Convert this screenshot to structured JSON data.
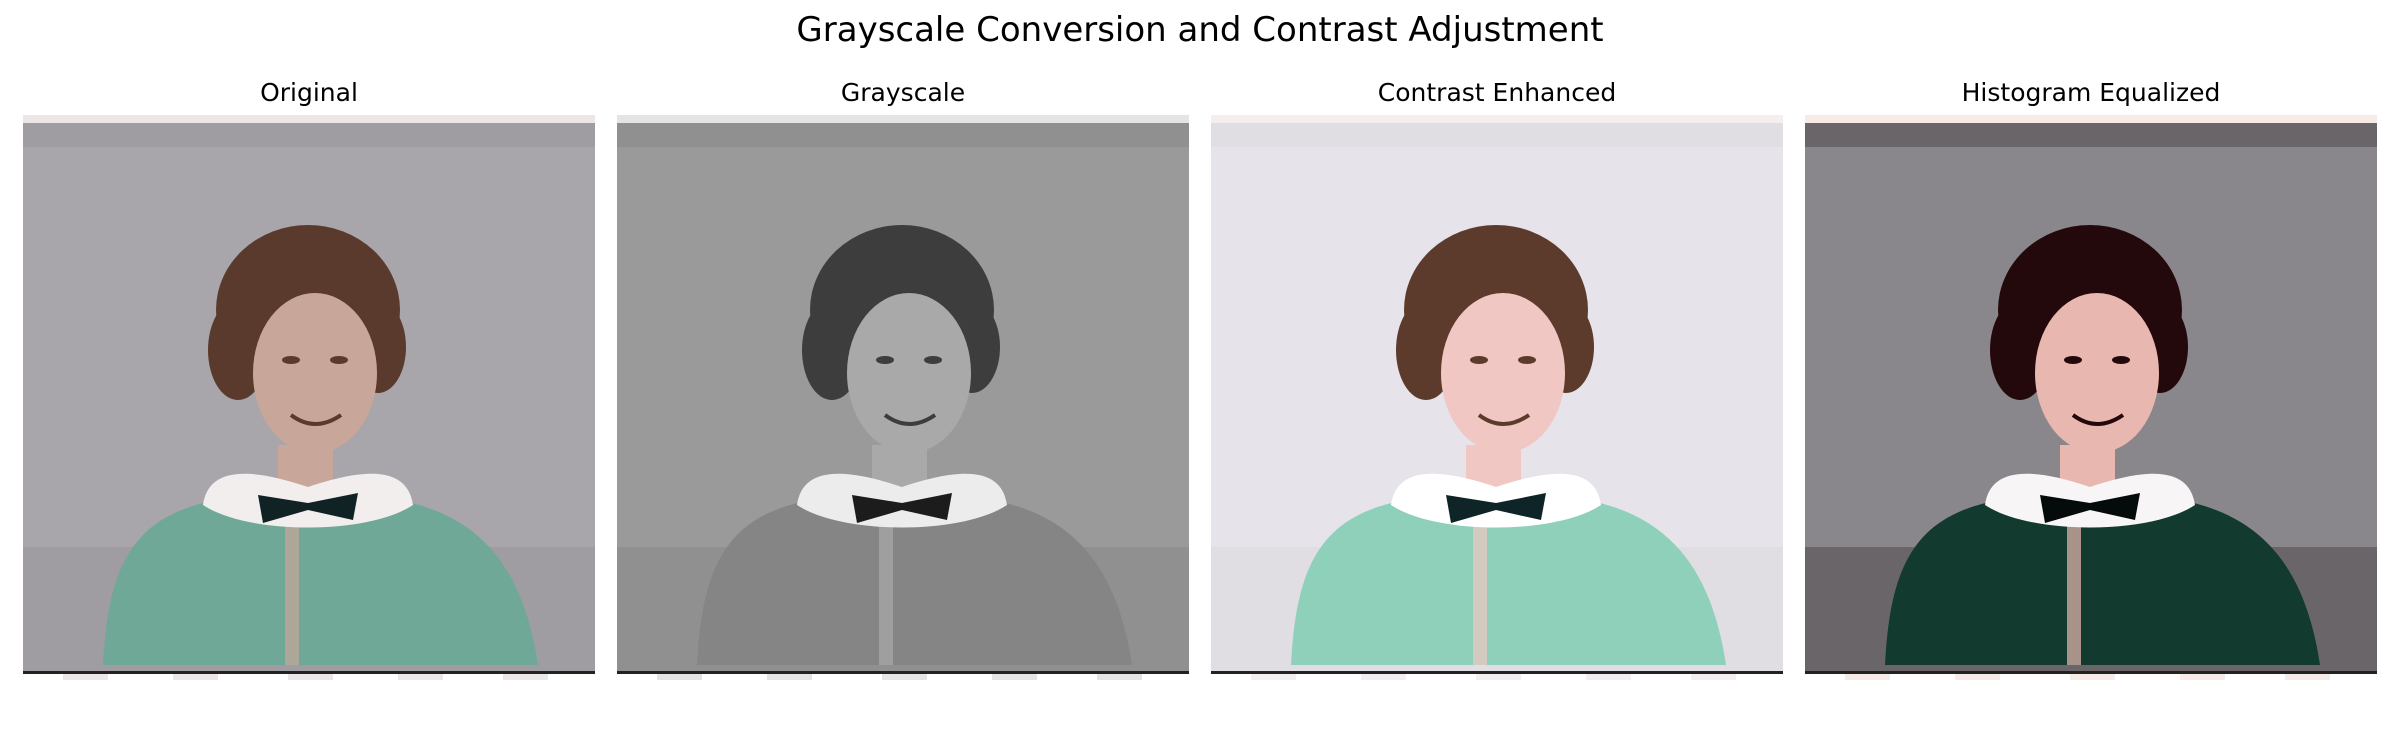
{
  "figure": {
    "title": "Grayscale Conversion and Contrast Adjustment"
  },
  "panels": [
    {
      "title": "Original",
      "image_icon": "portrait-woman-original",
      "colors": {
        "bg": "#a8a6ab",
        "hair": "#5a3a2c",
        "skin": "#c9a69a",
        "jacket": "#6fa896",
        "collar": "#f2eeee",
        "bow": "#102224",
        "edge": "#ece7e6",
        "shadow": "#8f8c90"
      }
    },
    {
      "title": "Grayscale",
      "image_icon": "portrait-woman-grayscale",
      "colors": {
        "bg": "#9a9a9a",
        "hair": "#3d3d3d",
        "skin": "#a9a9a9",
        "jacket": "#858585",
        "collar": "#ececec",
        "bow": "#1c1c1c",
        "edge": "#e4e4e4",
        "shadow": "#7d7d7d"
      }
    },
    {
      "title": "Contrast Enhanced",
      "image_icon": "portrait-woman-contrast",
      "colors": {
        "bg": "#e6e3ea",
        "hair": "#5d3b2c",
        "skin": "#f0c7c2",
        "jacket": "#8fd0bb",
        "collar": "#ffffff",
        "bow": "#0e2426",
        "edge": "#f4efee",
        "shadow": "#d5d2d8"
      }
    },
    {
      "title": "Histogram Equalized",
      "image_icon": "portrait-woman-equalized",
      "colors": {
        "bg": "#8a878c",
        "hair": "#24090c",
        "skin": "#e8b8b0",
        "jacket": "#123a2e",
        "collar": "#f7f5f5",
        "bow": "#050a0a",
        "edge": "#f7ebe8",
        "shadow": "#2a2528"
      }
    }
  ]
}
